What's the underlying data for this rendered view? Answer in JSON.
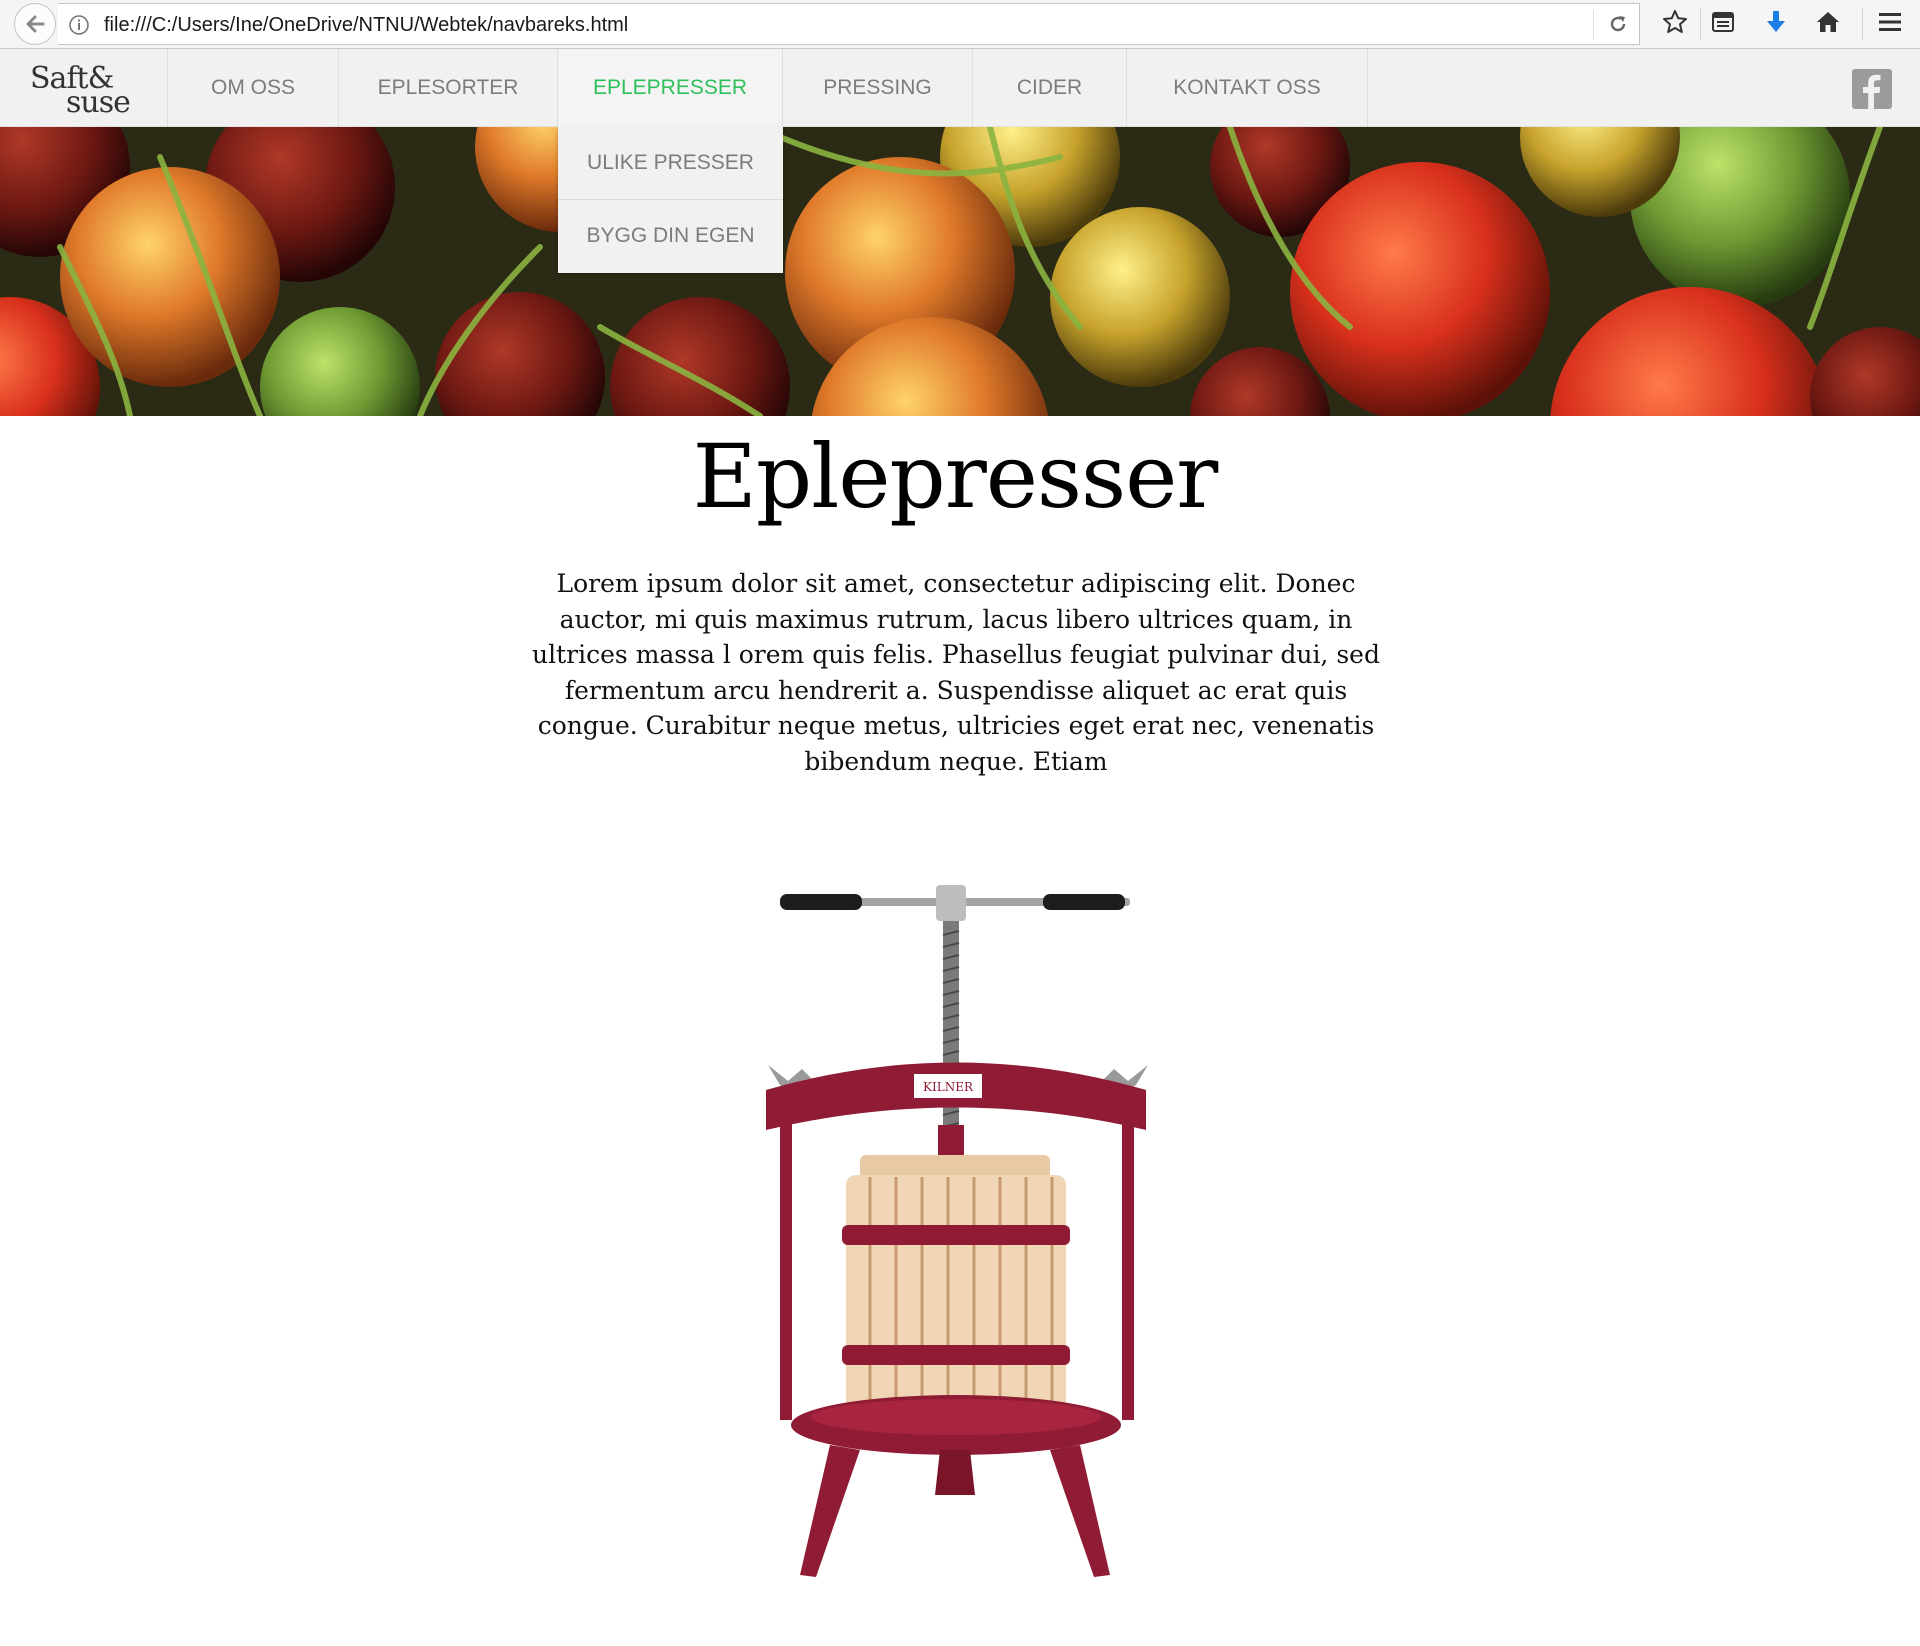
{
  "browser": {
    "url": "file:///C:/Users/Ine/OneDrive/NTNU/Webtek/navbareks.html",
    "icons": [
      "back-arrow-icon",
      "info-icon",
      "reload-icon",
      "star-icon",
      "reading-list-icon",
      "download-icon",
      "home-icon",
      "menu-icon"
    ]
  },
  "nav": {
    "logo_top": "Saft&",
    "logo_bottom": "suse",
    "items": [
      {
        "label": "OM OSS"
      },
      {
        "label": "EPLESORTER"
      },
      {
        "label": "EPLEPRESSER"
      },
      {
        "label": "PRESSING"
      },
      {
        "label": "CIDER"
      },
      {
        "label": "KONTAKT OSS"
      }
    ],
    "active_color": "#2ec05a",
    "dropdown": [
      {
        "label": "ULIKE PRESSER"
      },
      {
        "label": "BYGG DIN EGEN"
      }
    ]
  },
  "main": {
    "title": "Eplepresser",
    "body": "Lorem ipsum dolor sit amet, consectetur adipiscing elit. Donec auctor, mi quis maximus rutrum, lacus libero ultrices quam, in ultrices massa l orem quis felis. Phasellus feugiat pulvinar dui, sed fermentum arcu hendrerit a. Suspendisse aliquet ac erat quis congue. Curabitur neque metus, ultricies eget erat nec, venenatis bibendum neque. Etiam",
    "press_brand": "KILNER"
  }
}
